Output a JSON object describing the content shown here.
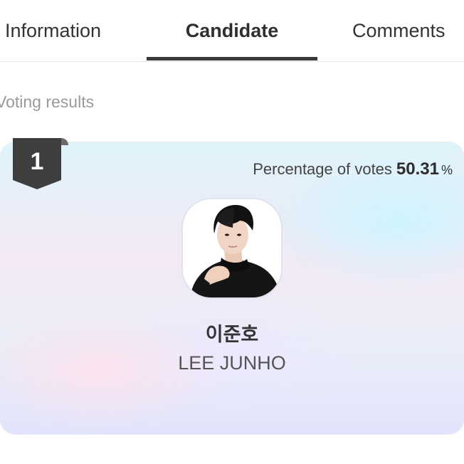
{
  "tabs": {
    "information": "Information",
    "candidate": "Candidate",
    "comments": "Comments"
  },
  "section": {
    "title": "Voting results"
  },
  "candidate": {
    "rank": "1",
    "votes_label": "Percentage of votes",
    "votes_value": "50.31",
    "votes_unit": "%",
    "name_korean": "이준호",
    "name_english": "LEE JUNHO"
  },
  "colors": {
    "active_tab_underline": "#3a3a3a",
    "rank_badge": "#3e3e3e"
  }
}
